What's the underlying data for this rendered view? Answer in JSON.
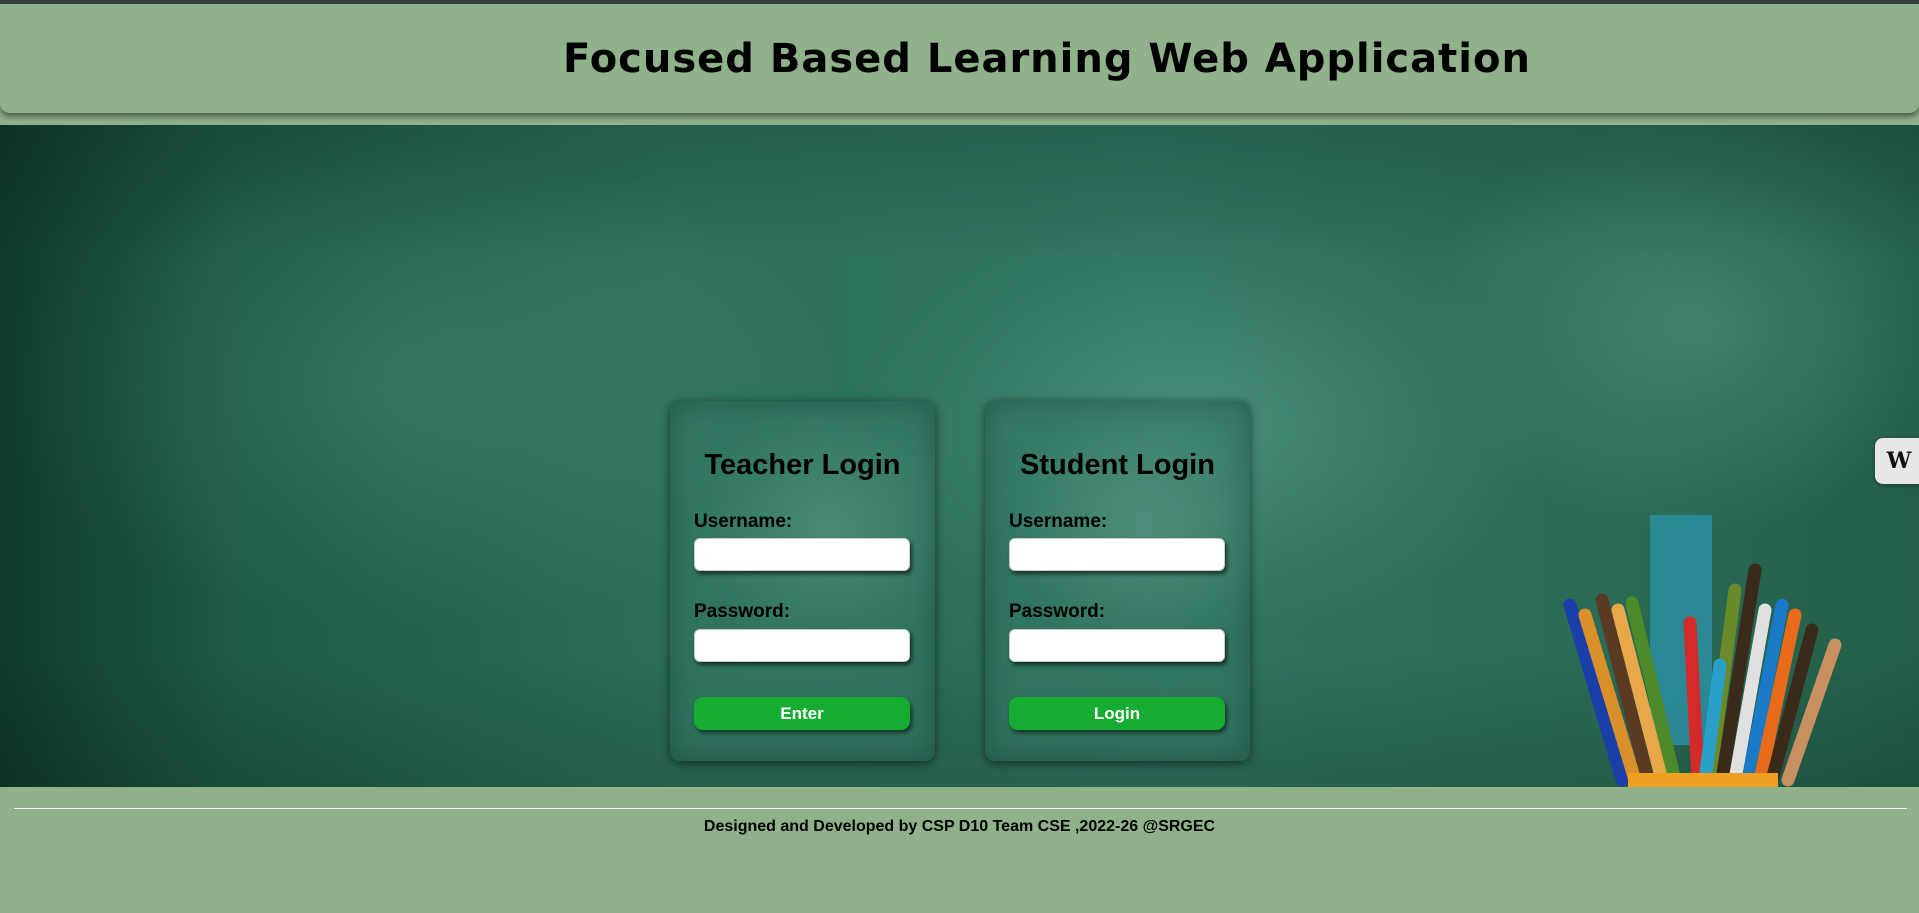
{
  "header": {
    "title": "Focused Based Learning Web Application"
  },
  "teacher_login": {
    "title": "Teacher Login",
    "username_label": "Username:",
    "username_value": "",
    "password_label": "Password:",
    "password_value": "",
    "submit_label": "Enter"
  },
  "student_login": {
    "title": "Student Login",
    "username_label": "Username:",
    "username_value": "",
    "password_label": "Password:",
    "password_value": "",
    "submit_label": "Login"
  },
  "side_widget": {
    "glyph": "W",
    "icon": "w-logo-icon"
  },
  "footer": {
    "text": "Designed and Developed by CSP D10 Team CSE ,2022-26 @SRGEC"
  },
  "colors": {
    "header_bg": "#8fb28a",
    "button_green": "#14ad32",
    "board_green": "#2c705a"
  }
}
